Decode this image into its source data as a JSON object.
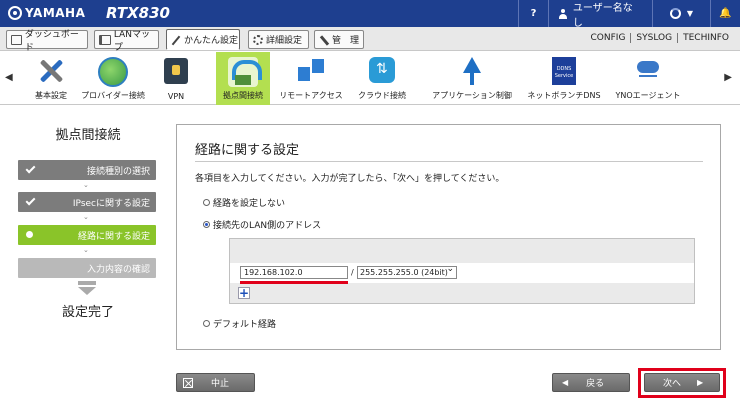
{
  "header": {
    "brand": "YAMAHA",
    "model": "RTX830",
    "help_label": "?",
    "user_label": "ユーザー名なし",
    "status_caret": "▼",
    "bell_label": "🔔"
  },
  "tabs": [
    {
      "label": "ダッシュボード"
    },
    {
      "label": "LANマップ"
    },
    {
      "label": "かんたん設定"
    },
    {
      "label": "詳細設定"
    },
    {
      "label": "管　理"
    }
  ],
  "top_links": [
    "CONFIG",
    "SYSLOG",
    "TECHINFO"
  ],
  "nav": {
    "prev": "◀",
    "next": "▶",
    "items": [
      {
        "label": "基本設定"
      },
      {
        "label": "プロバイダー接続"
      },
      {
        "label": "VPN"
      },
      {
        "label": "拠点間接続"
      },
      {
        "label": "リモートアクセス"
      },
      {
        "label": "クラウド接続"
      },
      {
        "label": "アプリケーション制御"
      },
      {
        "label": "ネットボランチDNS"
      },
      {
        "label": "YNOエージェント"
      }
    ],
    "ddns_icon_text": "DDNS Service"
  },
  "sidebar": {
    "title": "拠点間接続",
    "steps": [
      {
        "label": "接続種別の選択"
      },
      {
        "label": "IPsecに関する設定"
      },
      {
        "label": "経路に関する設定"
      },
      {
        "label": "入力内容の確認"
      }
    ],
    "complete": "設定完了"
  },
  "panel": {
    "title": "経路に関する設定",
    "description": "各項目を入力してください。入力が完了したら、「次へ」を押してください。",
    "option_none": "経路を設定しない",
    "option_lan": "接続先のLAN側のアドレス",
    "ip_value": "192.168.102.0",
    "slash": "/",
    "mask_value": "255.255.255.0 (24bit)",
    "add_label": "+",
    "option_default": "デフォルト経路"
  },
  "buttons": {
    "cancel": "中止",
    "back": "戻る",
    "next": "次へ",
    "back_arrow": "◀",
    "next_arrow": "▶"
  }
}
